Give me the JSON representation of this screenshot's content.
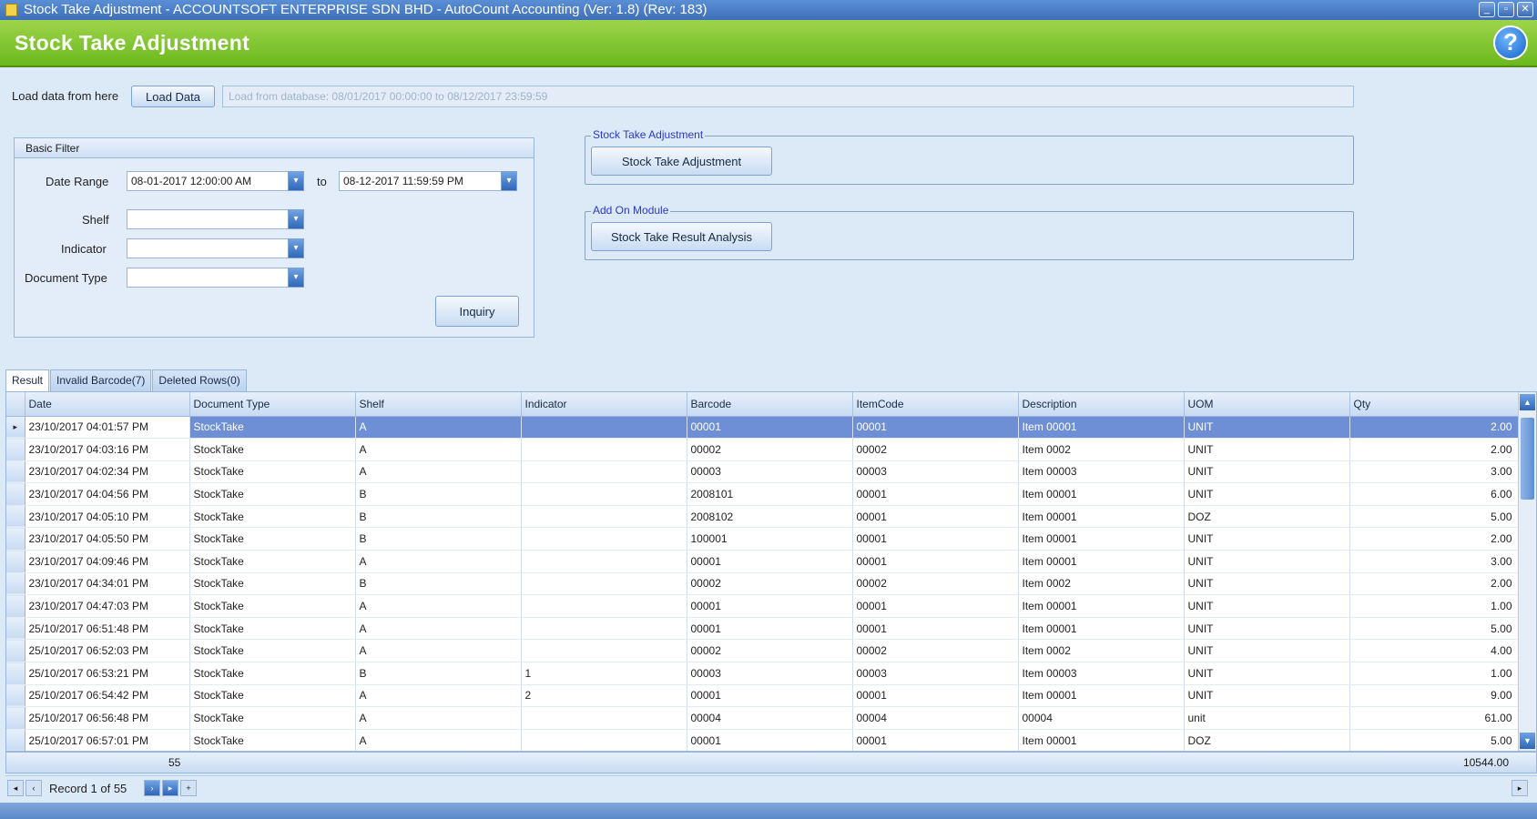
{
  "window": {
    "title": "Stock Take Adjustment - ACCOUNTSOFT ENTERPRISE SDN BHD - AutoCount Accounting (Ver: 1.8) (Rev: 183)",
    "controls": [
      "minimize",
      "restore",
      "close"
    ]
  },
  "header": {
    "title": "Stock Take Adjustment",
    "help_label": "?"
  },
  "load": {
    "label": "Load data from here",
    "button_label": "Load Data",
    "info_text": "Load from database: 08/01/2017 00:00:00 to 08/12/2017 23:59:59"
  },
  "filter": {
    "title": "Basic Filter",
    "date_range_label": "Date Range",
    "date_from": "08-01-2017 12:00:00 AM",
    "to_label": "to",
    "date_to": "08-12-2017 11:59:59 PM",
    "shelf_label": "Shelf",
    "shelf_value": "",
    "indicator_label": "Indicator",
    "indicator_value": "",
    "doctype_label": "Document Type",
    "doctype_value": "",
    "inquiry_label": "Inquiry"
  },
  "groups": {
    "stock_take": {
      "title": "Stock Take Adjustment",
      "button_label": "Stock Take Adjustment"
    },
    "addon": {
      "title": "Add On Module",
      "button_label": "Stock Take Result Analysis"
    }
  },
  "tabs": [
    {
      "label": "Result",
      "active": true
    },
    {
      "label": "Invalid Barcode(7)",
      "active": false
    },
    {
      "label": "Deleted Rows(0)",
      "active": false
    }
  ],
  "grid": {
    "columns": [
      "Date",
      "Document Type",
      "Shelf",
      "Indicator",
      "Barcode",
      "ItemCode",
      "Description",
      "UOM",
      "Qty"
    ],
    "rows": [
      [
        "23/10/2017 04:01:57 PM",
        "StockTake",
        "A",
        "",
        "00001",
        "00001",
        "Item 00001",
        "UNIT",
        "2.00"
      ],
      [
        "23/10/2017 04:03:16 PM",
        "StockTake",
        "A",
        "",
        "00002",
        "00002",
        "Item 0002",
        "UNIT",
        "2.00"
      ],
      [
        "23/10/2017 04:02:34 PM",
        "StockTake",
        "A",
        "",
        "00003",
        "00003",
        "Item 00003",
        "UNIT",
        "3.00"
      ],
      [
        "23/10/2017 04:04:56 PM",
        "StockTake",
        "B",
        "",
        "2008101",
        "00001",
        "Item 00001",
        "UNIT",
        "6.00"
      ],
      [
        "23/10/2017 04:05:10 PM",
        "StockTake",
        "B",
        "",
        "2008102",
        "00001",
        "Item 00001",
        "DOZ",
        "5.00"
      ],
      [
        "23/10/2017 04:05:50 PM",
        "StockTake",
        "B",
        "",
        "100001",
        "00001",
        "Item 00001",
        "UNIT",
        "2.00"
      ],
      [
        "23/10/2017 04:09:46 PM",
        "StockTake",
        "A",
        "",
        "00001",
        "00001",
        "Item 00001",
        "UNIT",
        "3.00"
      ],
      [
        "23/10/2017 04:34:01 PM",
        "StockTake",
        "B",
        "",
        "00002",
        "00002",
        "Item 0002",
        "UNIT",
        "2.00"
      ],
      [
        "23/10/2017 04:47:03 PM",
        "StockTake",
        "A",
        "",
        "00001",
        "00001",
        "Item 00001",
        "UNIT",
        "1.00"
      ],
      [
        "25/10/2017 06:51:48 PM",
        "StockTake",
        "A",
        "",
        "00001",
        "00001",
        "Item 00001",
        "UNIT",
        "5.00"
      ],
      [
        "25/10/2017 06:52:03 PM",
        "StockTake",
        "A",
        "",
        "00002",
        "00002",
        "Item 0002",
        "UNIT",
        "4.00"
      ],
      [
        "25/10/2017 06:53:21 PM",
        "StockTake",
        "B",
        "1",
        "00003",
        "00003",
        "Item 00003",
        "UNIT",
        "1.00"
      ],
      [
        "25/10/2017 06:54:42 PM",
        "StockTake",
        "A",
        "2",
        "00001",
        "00001",
        "Item 00001",
        "UNIT",
        "9.00"
      ],
      [
        "25/10/2017 06:56:48 PM",
        "StockTake",
        "A",
        "",
        "00004",
        "00004",
        "00004",
        "unit",
        "61.00"
      ],
      [
        "25/10/2017 06:57:01 PM",
        "StockTake",
        "A",
        "",
        "00001",
        "00001",
        "Item 00001",
        "DOZ",
        "5.00"
      ]
    ],
    "selected_row": 0,
    "footer_count": "55",
    "footer_total": "10544.00"
  },
  "navigator": {
    "record_text": "Record 1 of 55"
  }
}
